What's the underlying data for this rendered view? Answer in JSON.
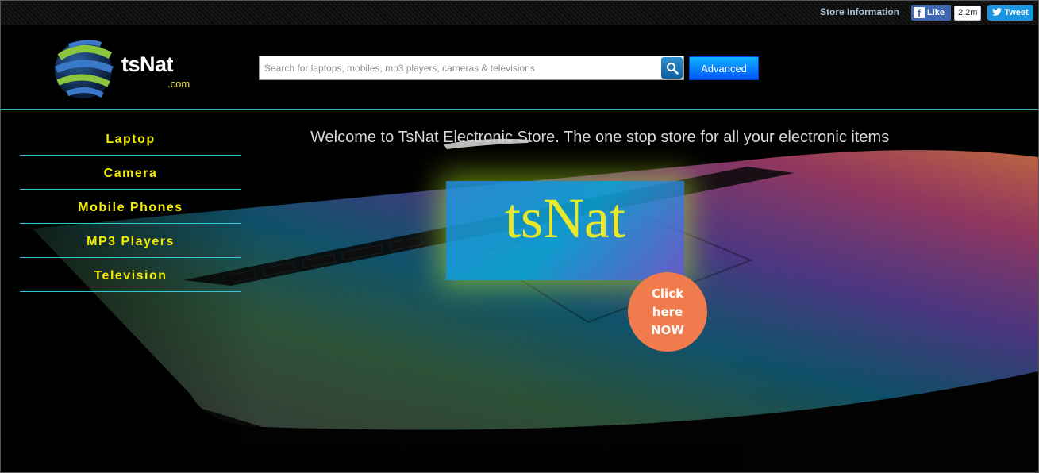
{
  "topbar": {
    "store_info": "Store Information",
    "fb_like_label": "Like",
    "fb_like_count": "2.2m",
    "tweet_label": "Tweet"
  },
  "header": {
    "logo_name": "tsNat",
    "logo_suffix": ".com",
    "search_placeholder": "Search for laptops, mobiles, mp3 players, cameras & televisions",
    "search_value": "",
    "advanced_label": "Advanced"
  },
  "sidebar": {
    "items": [
      {
        "label": "Laptop"
      },
      {
        "label": "Camera"
      },
      {
        "label": "Mobile Phones"
      },
      {
        "label": "MP3 Players"
      },
      {
        "label": "Television"
      }
    ]
  },
  "main": {
    "welcome": "Welcome to TsNat Electronic Store. The one stop store for all your electronic items",
    "promo_text": "tsNat",
    "cta_line1": "Click",
    "cta_line2": "here",
    "cta_line3": "NOW"
  },
  "colors": {
    "nav_text": "#f5ee00",
    "nav_divider": "#33c9d6",
    "cta": "#f07b4c",
    "advanced": "#0a7cff",
    "promo_glow": "#bef028"
  },
  "icons": {
    "search": "search-icon",
    "facebook": "facebook-icon",
    "twitter": "twitter-icon",
    "logo": "globe-logo-icon"
  }
}
